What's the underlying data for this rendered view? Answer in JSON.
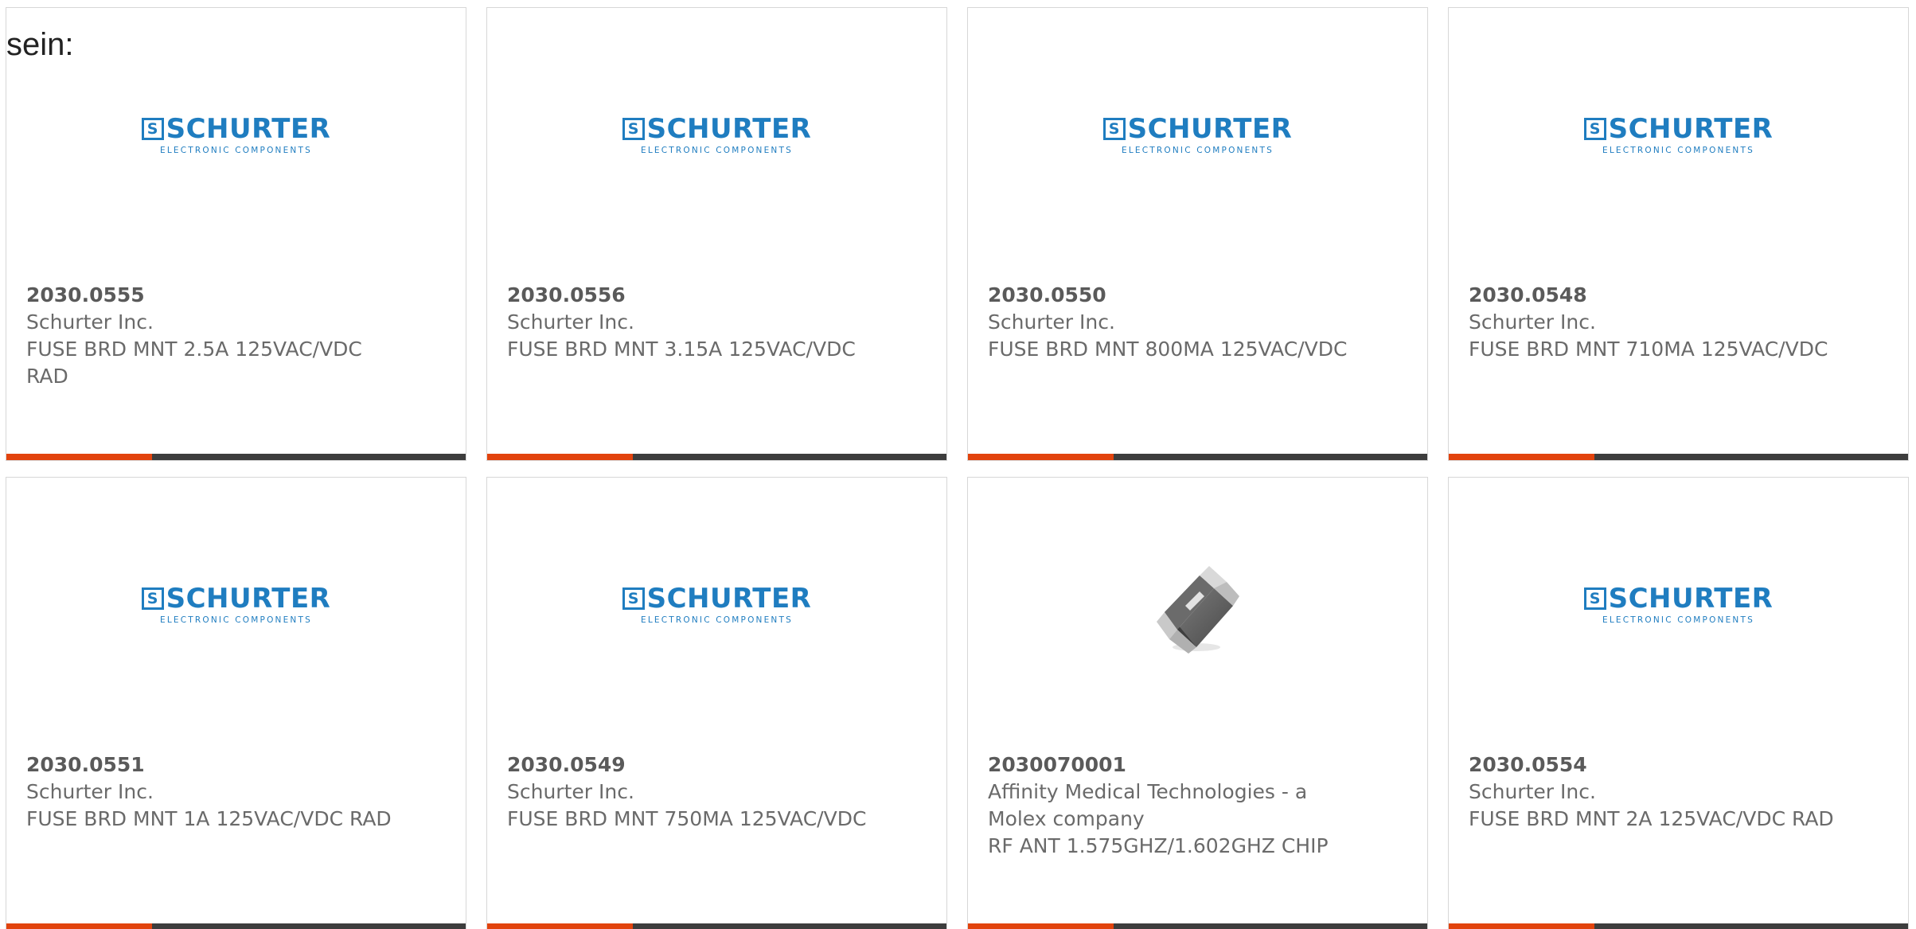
{
  "intro_text": "sein:",
  "brand_logo": {
    "name": "SCHURTER",
    "mark": "S",
    "tagline": "ELECTRONIC COMPONENTS",
    "color": "#1f7dc0"
  },
  "accent_color": "#e2430d",
  "products": [
    {
      "part_number": "2030.0555",
      "manufacturer": "Schurter Inc.",
      "description": "FUSE BRD MNT 2.5A 125VAC/VDC RAD",
      "image": "schurter-logo"
    },
    {
      "part_number": "2030.0556",
      "manufacturer": "Schurter Inc.",
      "description": "FUSE BRD MNT 3.15A 125VAC/VDC",
      "image": "schurter-logo"
    },
    {
      "part_number": "2030.0550",
      "manufacturer": "Schurter Inc.",
      "description": "FUSE BRD MNT 800MA 125VAC/VDC",
      "image": "schurter-logo"
    },
    {
      "part_number": "2030.0548",
      "manufacturer": "Schurter Inc.",
      "description": "FUSE BRD MNT 710MA 125VAC/VDC",
      "image": "schurter-logo"
    },
    {
      "part_number": "2030.0551",
      "manufacturer": "Schurter Inc.",
      "description": "FUSE BRD MNT 1A 125VAC/VDC RAD",
      "image": "schurter-logo"
    },
    {
      "part_number": "2030.0549",
      "manufacturer": "Schurter Inc.",
      "description": "FUSE BRD MNT 750MA 125VAC/VDC",
      "image": "schurter-logo"
    },
    {
      "part_number": "2030070001",
      "manufacturer": "Affinity Medical Technologies - a Molex company",
      "description": "RF ANT 1.575GHZ/1.602GHZ CHIP",
      "image": "chip-antenna-photo"
    },
    {
      "part_number": "2030.0554",
      "manufacturer": "Schurter Inc.",
      "description": "FUSE BRD MNT 2A 125VAC/VDC RAD",
      "image": "schurter-logo"
    }
  ]
}
